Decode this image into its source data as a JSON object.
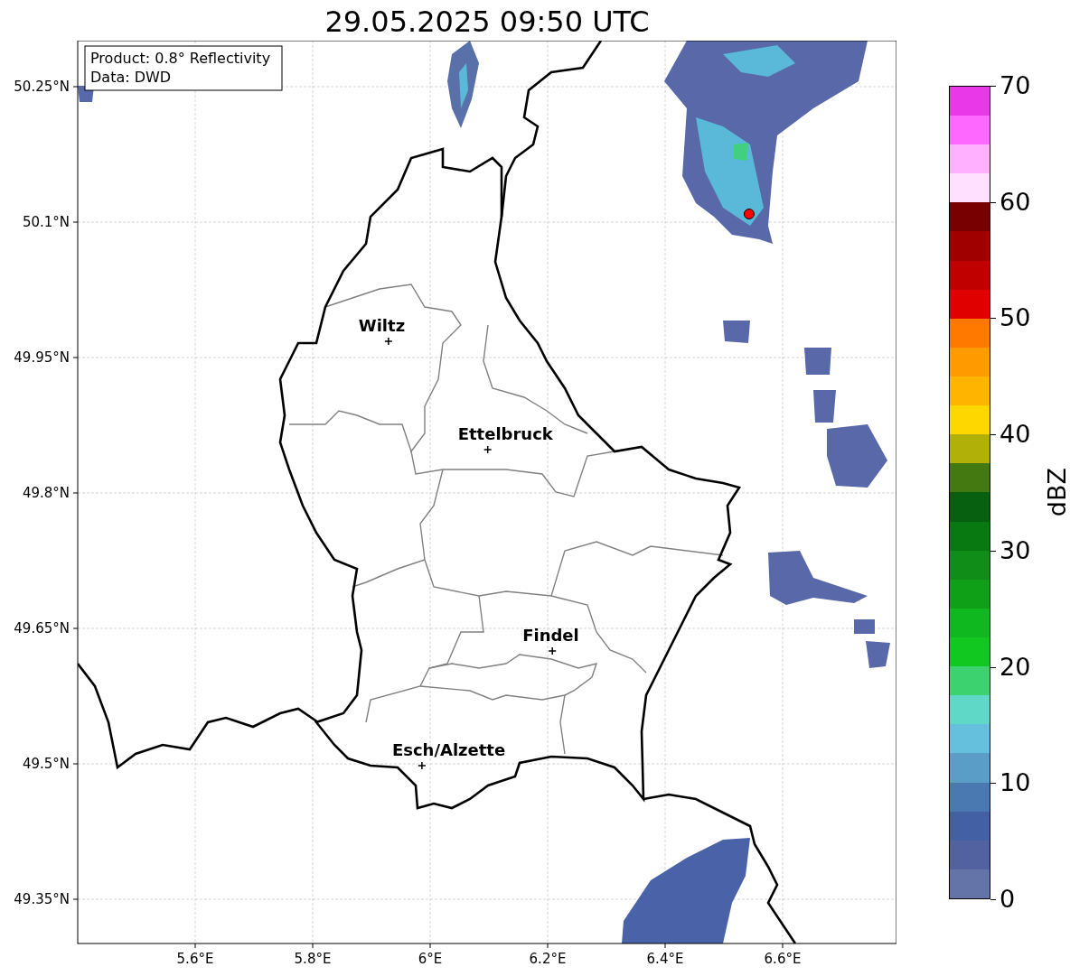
{
  "title": "29.05.2025 09:50 UTC",
  "info_box": {
    "lines": [
      "Product: 0.8° Reflectivity",
      "Data: DWD"
    ]
  },
  "lat_ticks": [
    "50.25°N",
    "50.1°N",
    "49.95°N",
    "49.8°N",
    "49.65°N",
    "49.5°N",
    "49.35°N"
  ],
  "lon_ticks": [
    "5.6°E",
    "5.8°E",
    "6°E",
    "6.2°E",
    "6.4°E",
    "6.6°E"
  ],
  "cities": [
    {
      "name": "Wiltz"
    },
    {
      "name": "Ettelbruck"
    },
    {
      "name": "Findel"
    },
    {
      "name": "Esch/Alzette"
    }
  ],
  "colorbar": {
    "label": "dBZ",
    "ticks": [
      "70",
      "60",
      "50",
      "40",
      "30",
      "20",
      "10",
      "0"
    ]
  }
}
